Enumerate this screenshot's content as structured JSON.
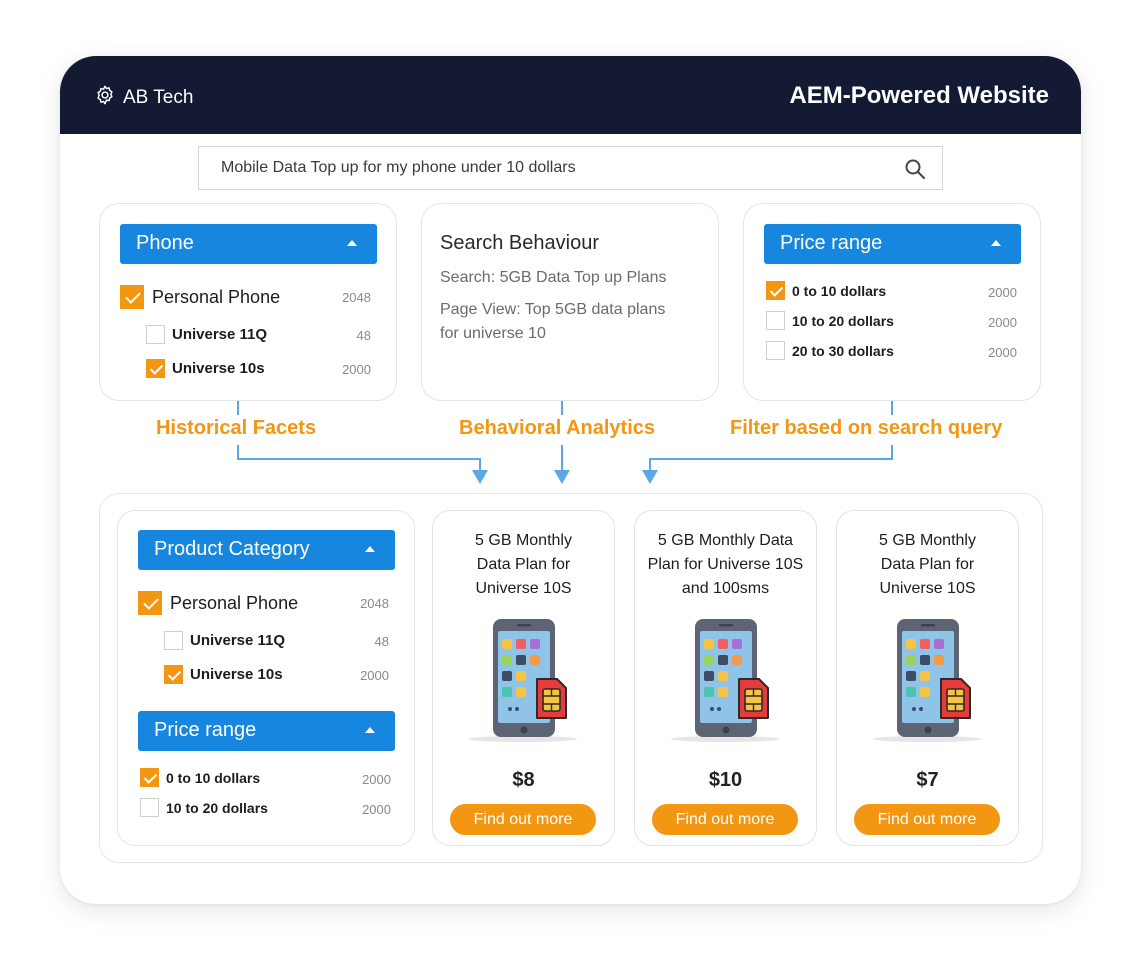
{
  "header": {
    "brand": "AB Tech",
    "title": "AEM-Powered Website"
  },
  "search": {
    "query": "Mobile Data Top up for my phone under 10 dollars"
  },
  "phone_facet": {
    "title": "Phone",
    "parent": {
      "label": "Personal Phone",
      "count": "2048",
      "checked": true
    },
    "items": [
      {
        "label": "Universe 11Q",
        "count": "48",
        "checked": false
      },
      {
        "label": "Universe 10s",
        "count": "2000",
        "checked": true
      }
    ]
  },
  "search_behaviour": {
    "title": "Search Behaviour",
    "search_line": "Search: 5GB Data Top up Plans",
    "page_view_line1": "Page View: Top 5GB data plans",
    "page_view_line2": "for universe 10"
  },
  "price_facet": {
    "title": "Price range",
    "items": [
      {
        "label": "0 to 10 dollars",
        "count": "2000",
        "checked": true
      },
      {
        "label": "10 to 20 dollars",
        "count": "2000",
        "checked": false
      },
      {
        "label": "20 to 30 dollars",
        "count": "2000",
        "checked": false
      }
    ]
  },
  "flow_labels": {
    "historical": "Historical Facets",
    "behavioral": "Behavioral Analytics",
    "filter": "Filter based on search query"
  },
  "result_filters": {
    "category": {
      "title": "Product Category",
      "parent": {
        "label": "Personal Phone",
        "count": "2048",
        "checked": true
      },
      "items": [
        {
          "label": "Universe 11Q",
          "count": "48",
          "checked": false
        },
        {
          "label": "Universe 10s",
          "count": "2000",
          "checked": true
        }
      ]
    },
    "price": {
      "title": "Price range",
      "items": [
        {
          "label": "0 to 10 dollars",
          "count": "2000",
          "checked": true
        },
        {
          "label": "10 to 20 dollars",
          "count": "2000",
          "checked": false
        }
      ]
    }
  },
  "products": [
    {
      "title_lines": [
        "5 GB Monthly",
        "Data Plan for",
        "Universe 10S"
      ],
      "price": "$8",
      "cta": "Find out more"
    },
    {
      "title_lines": [
        "5 GB Monthly Data",
        "Plan for Universe 10S",
        "and 100sms"
      ],
      "price": "$10",
      "cta": "Find out more"
    },
    {
      "title_lines": [
        "5 GB Monthly",
        "Data Plan for",
        "Universe 10S"
      ],
      "price": "$7",
      "cta": "Find out more"
    }
  ],
  "colors": {
    "header_bg": "#141a33",
    "facet_blue": "#1686df",
    "accent_orange": "#f39612",
    "arrow_blue": "#5aa9e6"
  },
  "icons": [
    "gear-icon",
    "search-icon",
    "caret-up-icon",
    "checkbox-icon",
    "arrow-down-icon",
    "phone-sim-icon"
  ]
}
